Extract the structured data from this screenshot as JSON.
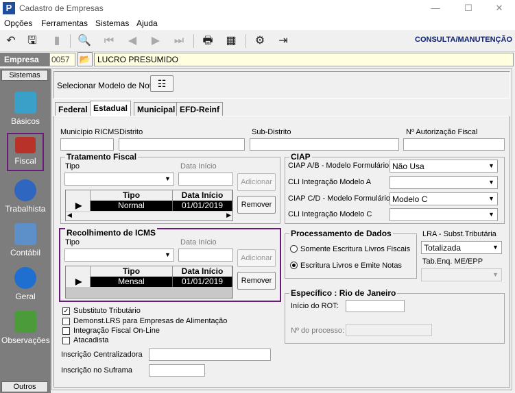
{
  "window": {
    "title": "Cadastro de Empresas",
    "minimize": "—",
    "maximize": "☐",
    "close": "✕"
  },
  "menu": [
    "Opções",
    "Ferramentas",
    "Sistemas",
    "Ajuda"
  ],
  "mode_label": "CONSULTA/MANUTENÇÃO",
  "empresa": {
    "label": "Empresa",
    "code": "0057",
    "name": "LUCRO PRESUMIDO"
  },
  "sidebar": {
    "header": "Sistemas",
    "footer": "Outros",
    "items": [
      {
        "label": "Básicos",
        "icon": "folder-icon",
        "color": "#3aa0c8"
      },
      {
        "label": "Fiscal",
        "icon": "ledger-icon",
        "color": "#b8322a"
      },
      {
        "label": "Trabalhista",
        "icon": "worker-icon",
        "color": "#2f66c0"
      },
      {
        "label": "Contábil",
        "icon": "calculator-icon",
        "color": "#5d8fc9"
      },
      {
        "label": "Geral",
        "icon": "info-icon",
        "color": "#1f6fd0"
      },
      {
        "label": "Observações",
        "icon": "notes-icon",
        "color": "#4b9b3b"
      }
    ]
  },
  "modelo_nota": {
    "label": "Selecionar Modelo de Nota"
  },
  "tabs": [
    "Federal",
    "Estadual",
    "Municipal",
    "EFD-Reinf"
  ],
  "fields": {
    "municipio_ricms": "Município RICMS",
    "distrito": "Distrito",
    "sub_distrito": "Sub-Distrito",
    "autorizacao_fiscal": "Nº Autorização Fiscal"
  },
  "tratamento_fiscal": {
    "title": "Tratamento Fiscal",
    "tipo_label": "Tipo",
    "data_label": "Data Início",
    "add_button": "Adicionar",
    "remove_button": "Remover",
    "columns": [
      "Tipo",
      "Data Início"
    ],
    "rows": [
      {
        "tipo": "Normal",
        "data": "01/01/2019"
      }
    ]
  },
  "recolhimento_icms": {
    "title": "Recolhimento de ICMS",
    "tipo_label": "Tipo",
    "data_label": "Data Início",
    "add_button": "Adicionar",
    "remove_button": "Remover",
    "columns": [
      "Tipo",
      "Data Início"
    ],
    "rows": [
      {
        "tipo": "Mensal",
        "data": "01/01/2019"
      }
    ]
  },
  "ciap": {
    "title": "CIAP",
    "ab_label": "CIAP  A/B - Modelo Formulário",
    "ab_value": "Não Usa",
    "cli_a_label": "CLI Integração Modelo A",
    "cd_label": "CIAP C/D - Modelo Formulário",
    "cd_value": "Modelo C",
    "cli_c_label": "CLI Integração Modelo C"
  },
  "processamento": {
    "title": "Processamento de Dados",
    "option1": "Somente Escritura Livros Fiscais",
    "option2": "Escritura Livros e Emite Notas"
  },
  "lra": {
    "label": "LRA - Subst.Tributária",
    "value": "Totalizada",
    "tab_label": "Tab.Enq. ME/EPP"
  },
  "especifico": {
    "title": "Específico : Rio de Janeiro",
    "rot_label": "Início do ROT:",
    "processo_label": "Nº do processo:"
  },
  "checkboxes": [
    {
      "label": "Substituto Tributário",
      "checked": true
    },
    {
      "label": "Demonst.LRS para Empresas de Alimentação",
      "checked": false
    },
    {
      "label": "Integração Fiscal On-Line",
      "checked": false
    },
    {
      "label": "Atacadista",
      "checked": false
    }
  ],
  "inscricao_centralizadora": "Inscrição Centralizadora",
  "inscricao_suframa": "Inscrição no Suframa",
  "highlight_color": "#6a1b78"
}
